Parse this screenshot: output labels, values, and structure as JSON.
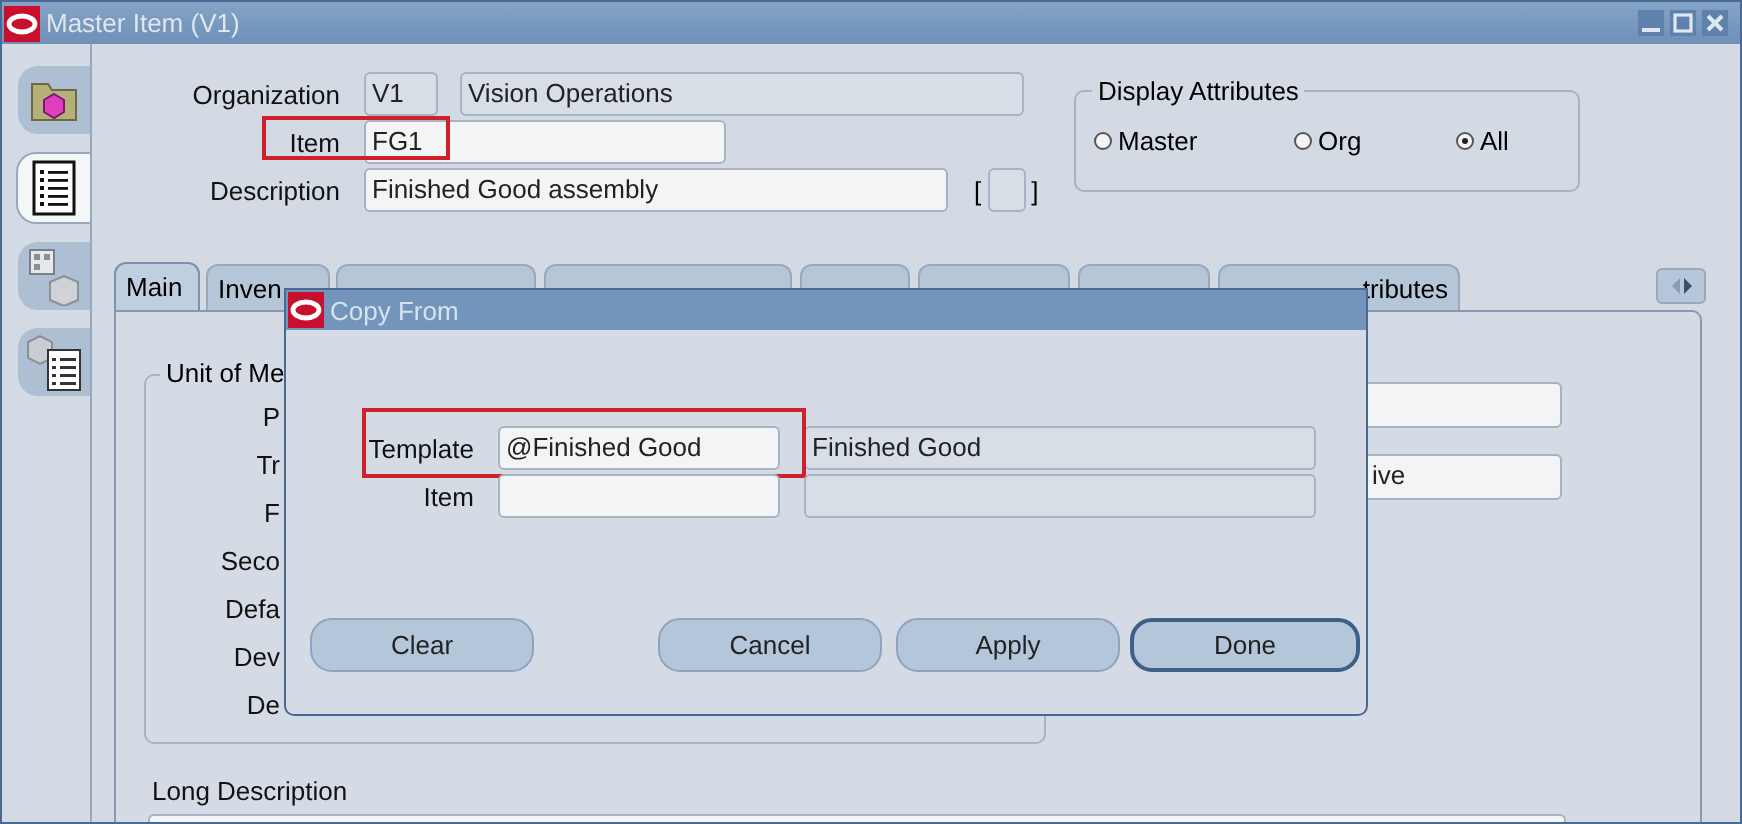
{
  "window": {
    "title": "Master Item (V1)"
  },
  "toolbar": [
    {
      "kind": "folder",
      "selected": false
    },
    {
      "kind": "document",
      "selected": true
    },
    {
      "kind": "building",
      "selected": false
    },
    {
      "kind": "catalog",
      "selected": false
    }
  ],
  "header": {
    "organization": {
      "label": "Organization",
      "code": "V1",
      "name": "Vision Operations"
    },
    "item": {
      "label": "Item",
      "value": "FG1",
      "highlighted": true
    },
    "description": {
      "label": "Description",
      "value": "Finished Good assembly",
      "flex_open": "[",
      "flex_close": "]"
    },
    "display_attributes": {
      "title": "Display Attributes",
      "options": [
        {
          "label": "Master",
          "selected": false
        },
        {
          "label": "Org",
          "selected": false
        },
        {
          "label": "All",
          "selected": true
        }
      ]
    }
  },
  "tabs": [
    {
      "label": "Main",
      "selected": true
    },
    {
      "label": "Inven",
      "selected": false
    },
    {
      "selected": false
    },
    {
      "selected": false
    },
    {
      "selected": false
    },
    {
      "selected": false
    },
    {
      "selected": false
    },
    {
      "label": "tributes",
      "selected": false
    }
  ],
  "panel": {
    "group": {
      "title": "Unit of Me",
      "labels": [
        "P",
        "Tr",
        "F",
        "Seco",
        "Defa",
        "Dev",
        "De"
      ]
    },
    "right_fields": [
      {
        "kind": "empty"
      },
      {
        "kind": "text",
        "value": "ive"
      }
    ],
    "long_description": {
      "label": "Long Description"
    }
  },
  "dialog": {
    "title": "Copy From",
    "rows": [
      {
        "label": "Template",
        "value": "@Finished Good",
        "description": "Finished Good",
        "highlighted": true
      },
      {
        "label": "Item",
        "highlighted": false
      }
    ],
    "buttons": [
      {
        "label": "Clear",
        "default": false
      },
      {
        "label": "Cancel",
        "default": false
      },
      {
        "label": "Apply",
        "default": false
      },
      {
        "label": "Done",
        "default": true
      }
    ]
  }
}
